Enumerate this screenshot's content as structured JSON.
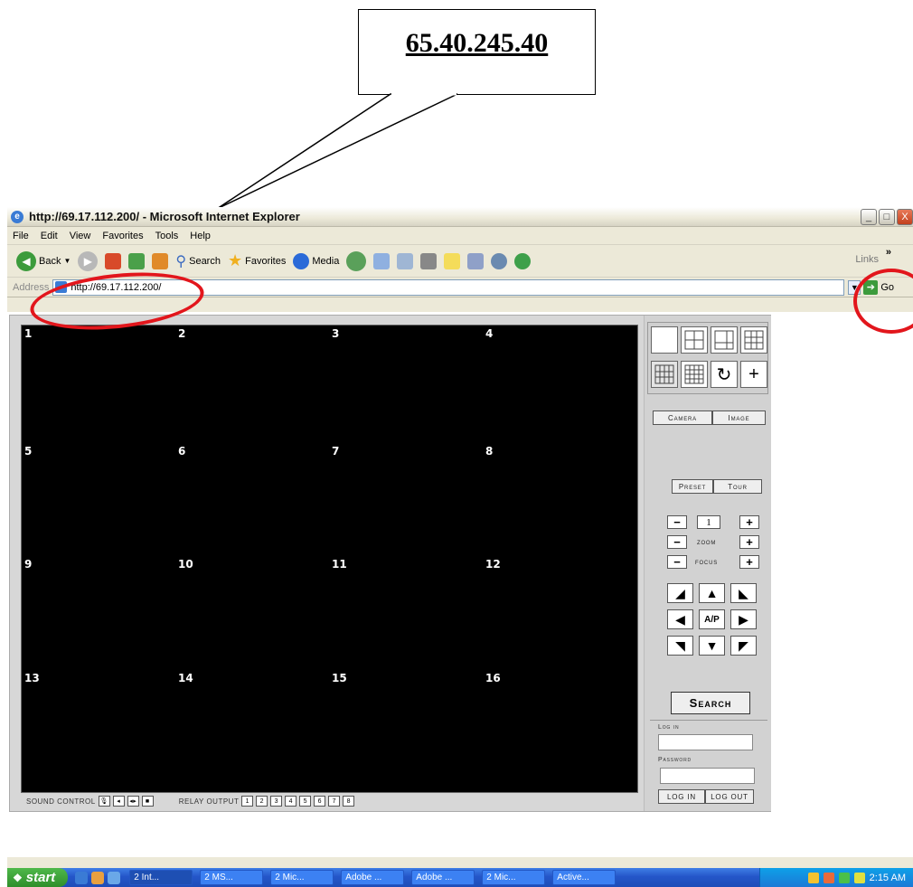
{
  "callout": {
    "text": "65.40.245.40"
  },
  "window": {
    "title": "http://69.17.112.200/ - Microsoft Internet Explorer",
    "controls": [
      "_",
      "□",
      "X"
    ]
  },
  "menu": [
    "File",
    "Edit",
    "View",
    "Favorites",
    "Tools",
    "Help"
  ],
  "toolbar": {
    "back": "Back",
    "search": "Search",
    "favorites": "Favorites",
    "media": "Media",
    "links": "Links",
    "more": "»"
  },
  "address": {
    "label": "Address",
    "url": "http://69.17.112.200/",
    "go": "Go"
  },
  "app": {
    "channels": [
      "1",
      "2",
      "3",
      "4",
      "5",
      "6",
      "7",
      "8",
      "9",
      "10",
      "11",
      "12",
      "13",
      "14",
      "15",
      "16"
    ],
    "camera_btn": "Camera",
    "image_btn": "Image",
    "preset_btn": "Preset",
    "tour_btn": "Tour",
    "preset_number": "1",
    "zoom_label": "zoom",
    "focus_label": "focus",
    "ap_label": "A/P",
    "search_btn": "Search",
    "login_label": "Log in",
    "password_label": "Password",
    "login_btn": "LOG IN",
    "logout_btn": "LOG OUT",
    "sound_control": "SOUND CONTROL",
    "relay_output": "RELAY OUTPUT",
    "relays": [
      "1",
      "2",
      "3",
      "4",
      "5",
      "6",
      "7",
      "8"
    ]
  },
  "taskbar": {
    "start": "start",
    "tasks": [
      "2 Int...",
      "2 MS...",
      "2 Mic...",
      "Adobe ...",
      "Adobe ...",
      "2 Mic...",
      "Active..."
    ],
    "time": "2:15 AM"
  },
  "colors": {
    "annotation_red": "#e2161c",
    "video_bg": "#000000",
    "panel_bg": "#d2d2d2"
  }
}
